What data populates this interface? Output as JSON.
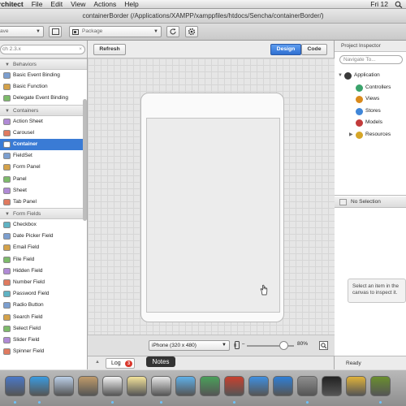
{
  "menubar": {
    "app_name": "rchitect",
    "items": [
      "File",
      "Edit",
      "View",
      "Actions",
      "Help"
    ],
    "clock": "Fri 12"
  },
  "window": {
    "title": "containerBorder (/Applications/XAMPP/xamppfiles/htdocs/Sencha/containerBorder/)"
  },
  "toolbar": {
    "save_select": "ave",
    "package_select": "Package"
  },
  "toolbox": {
    "search_value": "ch 2.3.x",
    "sections": [
      {
        "label": "Behaviors",
        "items": [
          "Basic Event Binding",
          "Basic Function",
          "Delegate Event Binding"
        ]
      },
      {
        "label": "Containers",
        "items": [
          "Action Sheet",
          "Carousel",
          "Container",
          "FieldSet",
          "Form Panel",
          "Panel",
          "Sheet",
          "Tab Panel"
        ]
      },
      {
        "label": "Form Fields",
        "items": [
          "Checkbox",
          "Date Picker Field",
          "Email Field",
          "File Field",
          "Hidden Field",
          "Number Field",
          "Password Field",
          "Radio Button",
          "Search Field",
          "Select Field",
          "Slider Field",
          "Spinner Field"
        ]
      }
    ],
    "selected": "Container"
  },
  "canvas": {
    "refresh_label": "Refresh",
    "design_label": "Design",
    "code_label": "Code",
    "device_select": "iPhone (320 x 480)",
    "zoom": "80%",
    "zoom_fraction": 0.8
  },
  "logbar": {
    "log_label": "Log",
    "log_count": "3",
    "notes_tip": "Notes"
  },
  "inspector": {
    "title": "Project Inspector",
    "search_placeholder": "Navigate To...",
    "tree": [
      {
        "label": "Application",
        "level": 0,
        "color": "#3a3a3a"
      },
      {
        "label": "Controllers",
        "level": 1,
        "color": "#3aa36b"
      },
      {
        "label": "Views",
        "level": 1,
        "color": "#d98a1c"
      },
      {
        "label": "Stores",
        "level": 1,
        "color": "#3f86d8"
      },
      {
        "label": "Models",
        "level": 1,
        "color": "#c23b3b"
      },
      {
        "label": "Resources",
        "level": 1,
        "color": "#d6a628"
      }
    ],
    "no_selection": "No Selection",
    "hint_line1": "Select an item in the",
    "hint_line2": "canvas to inspect it.",
    "status": "Ready"
  },
  "dock": {
    "icons": [
      "finder-icon",
      "safari-icon",
      "mail-icon",
      "photos-icon",
      "calendar-icon",
      "notes-icon",
      "textedit-icon",
      "messages-icon",
      "facetime-icon",
      "photo-booth-icon",
      "itunes-icon",
      "app-store-icon",
      "system-preferences-icon",
      "terminal-icon",
      "chrome-icon",
      "sencha-architect-icon"
    ]
  },
  "colors": {
    "selection_blue": "#3a7bd5",
    "design_blue": "#2f6fd0",
    "badge_red": "#d9362b"
  }
}
